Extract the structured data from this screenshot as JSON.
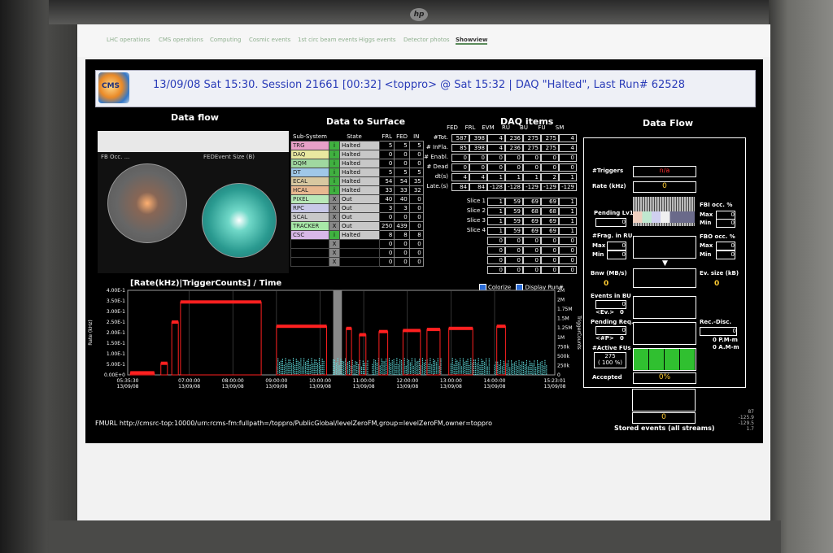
{
  "nav": {
    "tabs": [
      "LHC operations",
      "CMS operations",
      "Computing",
      "Cosmic events",
      "1st circ beam events",
      "Higgs events",
      "Detector photos",
      "Showview"
    ],
    "active": "Showview"
  },
  "header": {
    "logo_text": "CMS",
    "title": "13/09/08 Sat 15:30. Session 21661 [00:32]   <toppro> @ Sat 15:32 | DAQ \"Halted\", Last Run# 62528"
  },
  "data_flow_left": {
    "title": "Data flow",
    "plot1_label": "FB Occ. ...",
    "plot2_label": "FEDEvent Size (B)"
  },
  "data_to_surface": {
    "title": "Data to Surface",
    "headers": [
      "Sub-System",
      "State",
      "FRL",
      "FED",
      "IN"
    ],
    "rows": [
      {
        "name": "TRG",
        "ind": "i",
        "state": "Halted",
        "frl": "5",
        "fed": "5",
        "in": "5",
        "color": "#e8a0c8",
        "indcolor": "#40b040"
      },
      {
        "name": "DAQ",
        "ind": "i",
        "state": "Halted",
        "frl": "0",
        "fed": "0",
        "in": "0",
        "color": "#e8e8a0",
        "indcolor": "#40b040"
      },
      {
        "name": "DQM",
        "ind": "i",
        "state": "Halted",
        "frl": "0",
        "fed": "0",
        "in": "0",
        "color": "#a0d8a0",
        "indcolor": "#40b040"
      },
      {
        "name": "DT",
        "ind": "i",
        "state": "Halted",
        "frl": "5",
        "fed": "5",
        "in": "5",
        "color": "#a0c8e8",
        "indcolor": "#40b040"
      },
      {
        "name": "ECAL",
        "ind": "i",
        "state": "Halted",
        "frl": "54",
        "fed": "54",
        "in": "35",
        "color": "#d8c8a0",
        "indcolor": "#40b040"
      },
      {
        "name": "HCAL",
        "ind": "i",
        "state": "Halted",
        "frl": "33",
        "fed": "33",
        "in": "32",
        "color": "#e8b890",
        "indcolor": "#40b040"
      },
      {
        "name": "PIXEL",
        "ind": "X",
        "state": "Out",
        "frl": "40",
        "fed": "40",
        "in": "0",
        "color": "#b8e8b8",
        "indcolor": "#888888"
      },
      {
        "name": "RPC",
        "ind": "X",
        "state": "Out",
        "frl": "3",
        "fed": "3",
        "in": "0",
        "color": "#c8c8e8",
        "indcolor": "#888888"
      },
      {
        "name": "SCAL",
        "ind": "X",
        "state": "Out",
        "frl": "0",
        "fed": "0",
        "in": "0",
        "color": "#c8c8c8",
        "indcolor": "#888888"
      },
      {
        "name": "TRACKER",
        "ind": "X",
        "state": "Out",
        "frl": "250",
        "fed": "439",
        "in": "0",
        "color": "#a8e8a8",
        "indcolor": "#888888"
      },
      {
        "name": "CSC",
        "ind": "i",
        "state": "Halted",
        "frl": "8",
        "fed": "8",
        "in": "8",
        "color": "#d8b8e8",
        "indcolor": "#40b040"
      },
      {
        "name": "",
        "ind": "X",
        "state": "",
        "frl": "0",
        "fed": "0",
        "in": "0",
        "color": "#000000",
        "indcolor": "#888888"
      },
      {
        "name": "",
        "ind": "X",
        "state": "",
        "frl": "0",
        "fed": "0",
        "in": "0",
        "color": "#000000",
        "indcolor": "#888888"
      },
      {
        "name": "",
        "ind": "X",
        "state": "",
        "frl": "0",
        "fed": "0",
        "in": "0",
        "color": "#000000",
        "indcolor": "#888888"
      }
    ]
  },
  "daq_items": {
    "title": "DAQ items",
    "cols": [
      "FED",
      "FRL",
      "EVM",
      "RU",
      "BU",
      "FU",
      "SM"
    ],
    "rows": [
      {
        "label": "#Tot.",
        "vals": [
          "587",
          "398",
          "4",
          "236",
          "275",
          "275",
          "4"
        ]
      },
      {
        "label": "# InFla.",
        "vals": [
          "85",
          "398",
          "4",
          "236",
          "275",
          "275",
          "4"
        ]
      },
      {
        "label": "# Enabl.",
        "vals": [
          "0",
          "0",
          "0",
          "0",
          "0",
          "0",
          "0"
        ]
      },
      {
        "label": "# Dead",
        "vals": [
          "0",
          "0",
          "0",
          "0",
          "0",
          "0",
          "0"
        ]
      },
      {
        "label": "dt(s)",
        "vals": [
          "4",
          "4",
          "1",
          "1",
          "1",
          "2",
          "1"
        ]
      },
      {
        "label": "Late.(s)",
        "vals": [
          "84",
          "84",
          "-128",
          "-128",
          "-129",
          "-129",
          "-129"
        ]
      }
    ],
    "slices": [
      {
        "label": "Slice 1",
        "vals": [
          "1",
          "59",
          "69",
          "69",
          "1"
        ]
      },
      {
        "label": "Slice 2",
        "vals": [
          "1",
          "59",
          "68",
          "68",
          "1"
        ]
      },
      {
        "label": "Slice 3",
        "vals": [
          "1",
          "59",
          "69",
          "69",
          "1"
        ]
      },
      {
        "label": "Slice 4",
        "vals": [
          "1",
          "59",
          "69",
          "69",
          "1"
        ]
      },
      {
        "label": "",
        "vals": [
          "0",
          "0",
          "0",
          "0",
          "0"
        ]
      },
      {
        "label": "",
        "vals": [
          "0",
          "0",
          "0",
          "0",
          "0"
        ]
      },
      {
        "label": "",
        "vals": [
          "0",
          "0",
          "0",
          "0",
          "0"
        ]
      },
      {
        "label": "",
        "vals": [
          "0",
          "0",
          "0",
          "0",
          "0"
        ]
      }
    ]
  },
  "data_flow_right": {
    "title": "Data Flow",
    "triggers_label": "#Triggers",
    "triggers_value": "n/a",
    "rate_label": "Rate (kHz)",
    "rate_value": "0",
    "pending_lv1_label": "Pending Lv1",
    "pending_lv1_value": "0",
    "fbi_occ_label": "FBI occ. %",
    "fbi_max_label": "Max",
    "fbi_max": "0",
    "fbi_min_label": "Min",
    "fbi_min": "0",
    "frag_ru_label": "#Frag. in RU",
    "frag_max_label": "Max",
    "frag_max": "0",
    "frag_min_label": "Min",
    "frag_min": "0",
    "fbo_occ_label": "FBO occ. %",
    "fbo_max_label": "Max",
    "fbo_max": "0",
    "fbo_min_label": "Min",
    "fbo_min": "0",
    "bnw_label": "Bnw (MB/s)",
    "bnw_value": "0",
    "ev_size_label": "Ev. size (kB)",
    "ev_size_value": "0",
    "events_bu_label": "Events in BU",
    "events_bu_value": "0",
    "ev_label": "<Ev.>",
    "ev_value": "0",
    "pending_req_label": "Pending Req.",
    "pending_req_value": "0",
    "p_label": "<#P>",
    "p_value": "0",
    "active_fus_label": "#Active FUs",
    "active_fus_value": "275",
    "active_fus_pct": "( 100 %)",
    "accepted_label": "Accepted",
    "accepted_value": "0%",
    "rec_disc_label": "Rec.-Disc.",
    "rec_disc_value": "0",
    "pm_text": "0 P.M-m",
    "am_text": "0 A.M-m",
    "stored_label": "Stored events (all streams)",
    "stored_value": "0",
    "side_numbers": [
      "87",
      "-125.9",
      "-129.5",
      "1.7"
    ]
  },
  "rate_chart": {
    "colorize_label": "Colorize",
    "display_run_label": "Display Run#"
  },
  "footer": {
    "fmurl": "FMURL http://cmsrc-top:10000/urn:rcms-fm:fullpath=/toppro/PublicGlobal/levelZeroFM,group=levelZeroFM,owner=toppro"
  },
  "chart_data": {
    "type": "line",
    "title": "[Rate(kHz)|TriggerCounts] / Time",
    "ylabel": "Rate (kHz)",
    "y2label": "TriggerCounts",
    "ylim": [
      0,
      4.0
    ],
    "y_ticks": [
      "0.00E+0",
      "5.00E-1",
      "1.00E-1",
      "1.50E-1",
      "2.00E-1",
      "2.50E-1",
      "3.00E-1",
      "3.50E-1",
      "4.00E-1"
    ],
    "y2_ticks": [
      "0",
      "250k",
      "500k",
      "750k",
      "1M",
      "1.25M",
      "1.5M",
      "1.75M",
      "2M",
      "2M"
    ],
    "x_ticks": [
      {
        "t": "05:35:30",
        "d": "13/09/08"
      },
      {
        "t": "07:00:00",
        "d": "13/09/08"
      },
      {
        "t": "08:00:00",
        "d": "13/09/08"
      },
      {
        "t": "09:00:00",
        "d": "13/09/08"
      },
      {
        "t": "10:00:00",
        "d": "13/09/08"
      },
      {
        "t": "11:00:00",
        "d": "13/09/08"
      },
      {
        "t": "12:00:00",
        "d": "13/09/08"
      },
      {
        "t": "13:00:00",
        "d": "13/09/08"
      },
      {
        "t": "14:00:00",
        "d": "13/09/08"
      },
      {
        "t": "15:23:01",
        "d": "13/09/08"
      }
    ],
    "series": [
      {
        "color": "#ff2020",
        "segments": [
          [
            5.65,
            6.2,
            0.1
          ],
          [
            6.35,
            6.5,
            0.55
          ],
          [
            6.6,
            6.75,
            2.5
          ],
          [
            6.8,
            8.65,
            3.45
          ],
          [
            9.0,
            10.15,
            2.3
          ],
          [
            10.6,
            10.72,
            2.2
          ],
          [
            10.9,
            11.05,
            1.9
          ],
          [
            11.35,
            11.55,
            2.05
          ],
          [
            11.9,
            12.3,
            2.1
          ],
          [
            12.45,
            12.75,
            2.15
          ],
          [
            12.95,
            13.5,
            2.2
          ],
          [
            14.05,
            14.25,
            2.3
          ]
        ]
      },
      {
        "color": "#60e0e0",
        "segments": [
          [
            9.0,
            10.1,
            0.8
          ],
          [
            10.3,
            10.6,
            0.8
          ],
          [
            10.6,
            11.1,
            0.7
          ],
          [
            11.2,
            12.0,
            0.8
          ],
          [
            12.0,
            12.8,
            0.8
          ],
          [
            13.0,
            13.9,
            0.8
          ],
          [
            14.0,
            15.2,
            0.7
          ]
        ]
      }
    ]
  }
}
